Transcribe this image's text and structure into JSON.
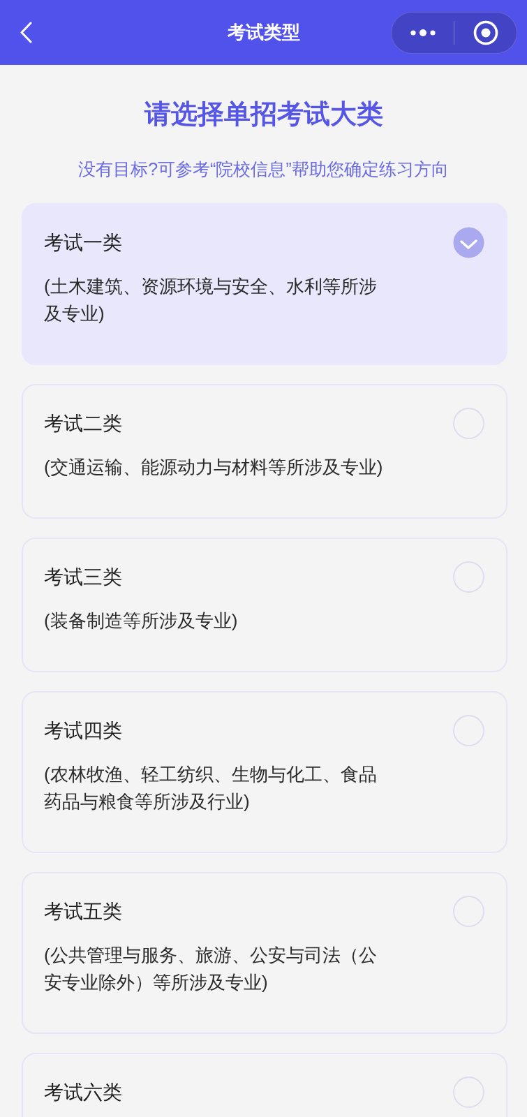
{
  "nav_bar": {
    "title": "考试类型"
  },
  "heading": "请选择单招考试大类",
  "hint": "没有目标?可参考“院校信息”帮助您确定练习方向",
  "categories": [
    {
      "title": "考试一类",
      "description_lines": [
        "(土木建筑、资源环境与安全、水利等所涉",
        "及专业)"
      ],
      "selected": true
    },
    {
      "title": "考试二类",
      "description_lines": [
        "(交通运输、能源动力与材料等所涉及专业)"
      ],
      "selected": false
    },
    {
      "title": "考试三类",
      "description_lines": [
        "(装备制造等所涉及专业)"
      ],
      "selected": false
    },
    {
      "title": "考试四类",
      "description_lines": [
        "(农林牧渔、轻工纺织、生物与化工、食品",
        "药品与粮食等所涉及行业)"
      ],
      "selected": false
    },
    {
      "title": "考试五类",
      "description_lines": [
        "(公共管理与服务、旅游、公安与司法（公",
        "安专业除外）等所涉及专业)"
      ],
      "selected": false
    },
    {
      "title": "考试六类",
      "selected": false
    }
  ]
}
